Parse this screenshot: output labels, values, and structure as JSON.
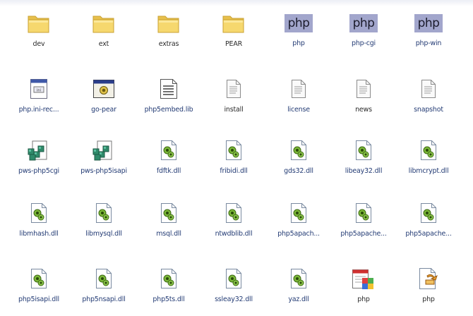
{
  "folder": {
    "files": [
      {
        "name": "dev",
        "icon": "folder-icon"
      },
      {
        "name": "ext",
        "icon": "folder-icon"
      },
      {
        "name": "extras",
        "icon": "folder-icon"
      },
      {
        "name": "PEAR",
        "icon": "folder-icon"
      },
      {
        "name": "php",
        "icon": "php-exe-icon",
        "badge": "php"
      },
      {
        "name": "php-cgi",
        "icon": "php-exe-icon",
        "badge": "php"
      },
      {
        "name": "php-win",
        "icon": "php-exe-icon",
        "badge": "php"
      },
      {
        "name": "php.ini-rec...",
        "icon": "ini-file-icon"
      },
      {
        "name": "go-pear",
        "icon": "batch-file-icon"
      },
      {
        "name": "php5embed.lib",
        "icon": "lib-file-icon"
      },
      {
        "name": "install",
        "icon": "text-file-icon"
      },
      {
        "name": "license",
        "icon": "text-file-icon"
      },
      {
        "name": "news",
        "icon": "text-file-icon"
      },
      {
        "name": "snapshot",
        "icon": "text-file-icon"
      },
      {
        "name": "pws-php5cgi",
        "icon": "registry-file-icon"
      },
      {
        "name": "pws-php5isapi",
        "icon": "registry-file-icon"
      },
      {
        "name": "fdftk.dll",
        "icon": "dll-file-icon"
      },
      {
        "name": "fribidi.dll",
        "icon": "dll-file-icon"
      },
      {
        "name": "gds32.dll",
        "icon": "dll-file-icon"
      },
      {
        "name": "libeay32.dll",
        "icon": "dll-file-icon"
      },
      {
        "name": "libmcrypt.dll",
        "icon": "dll-file-icon"
      },
      {
        "name": "libmhash.dll",
        "icon": "dll-file-icon"
      },
      {
        "name": "libmysql.dll",
        "icon": "dll-file-icon"
      },
      {
        "name": "msql.dll",
        "icon": "dll-file-icon"
      },
      {
        "name": "ntwdblib.dll",
        "icon": "dll-file-icon"
      },
      {
        "name": "php5apach...",
        "icon": "dll-file-icon"
      },
      {
        "name": "php5apache...",
        "icon": "dll-file-icon"
      },
      {
        "name": "php5apache...",
        "icon": "dll-file-icon"
      },
      {
        "name": "php5isapi.dll",
        "icon": "dll-file-icon"
      },
      {
        "name": "php5nsapi.dll",
        "icon": "dll-file-icon"
      },
      {
        "name": "php5ts.dll",
        "icon": "dll-file-icon"
      },
      {
        "name": "ssleay32.dll",
        "icon": "dll-file-icon"
      },
      {
        "name": "yaz.dll",
        "icon": "dll-file-icon"
      },
      {
        "name": "php",
        "icon": "php-ini-settings-icon"
      },
      {
        "name": "php",
        "icon": "php-script-icon"
      }
    ]
  },
  "colors": {
    "folder": "#f4d46c",
    "php_badge": "#a2a6cc",
    "label_link": "#233b74",
    "label_plain": "#2a2a2a"
  }
}
